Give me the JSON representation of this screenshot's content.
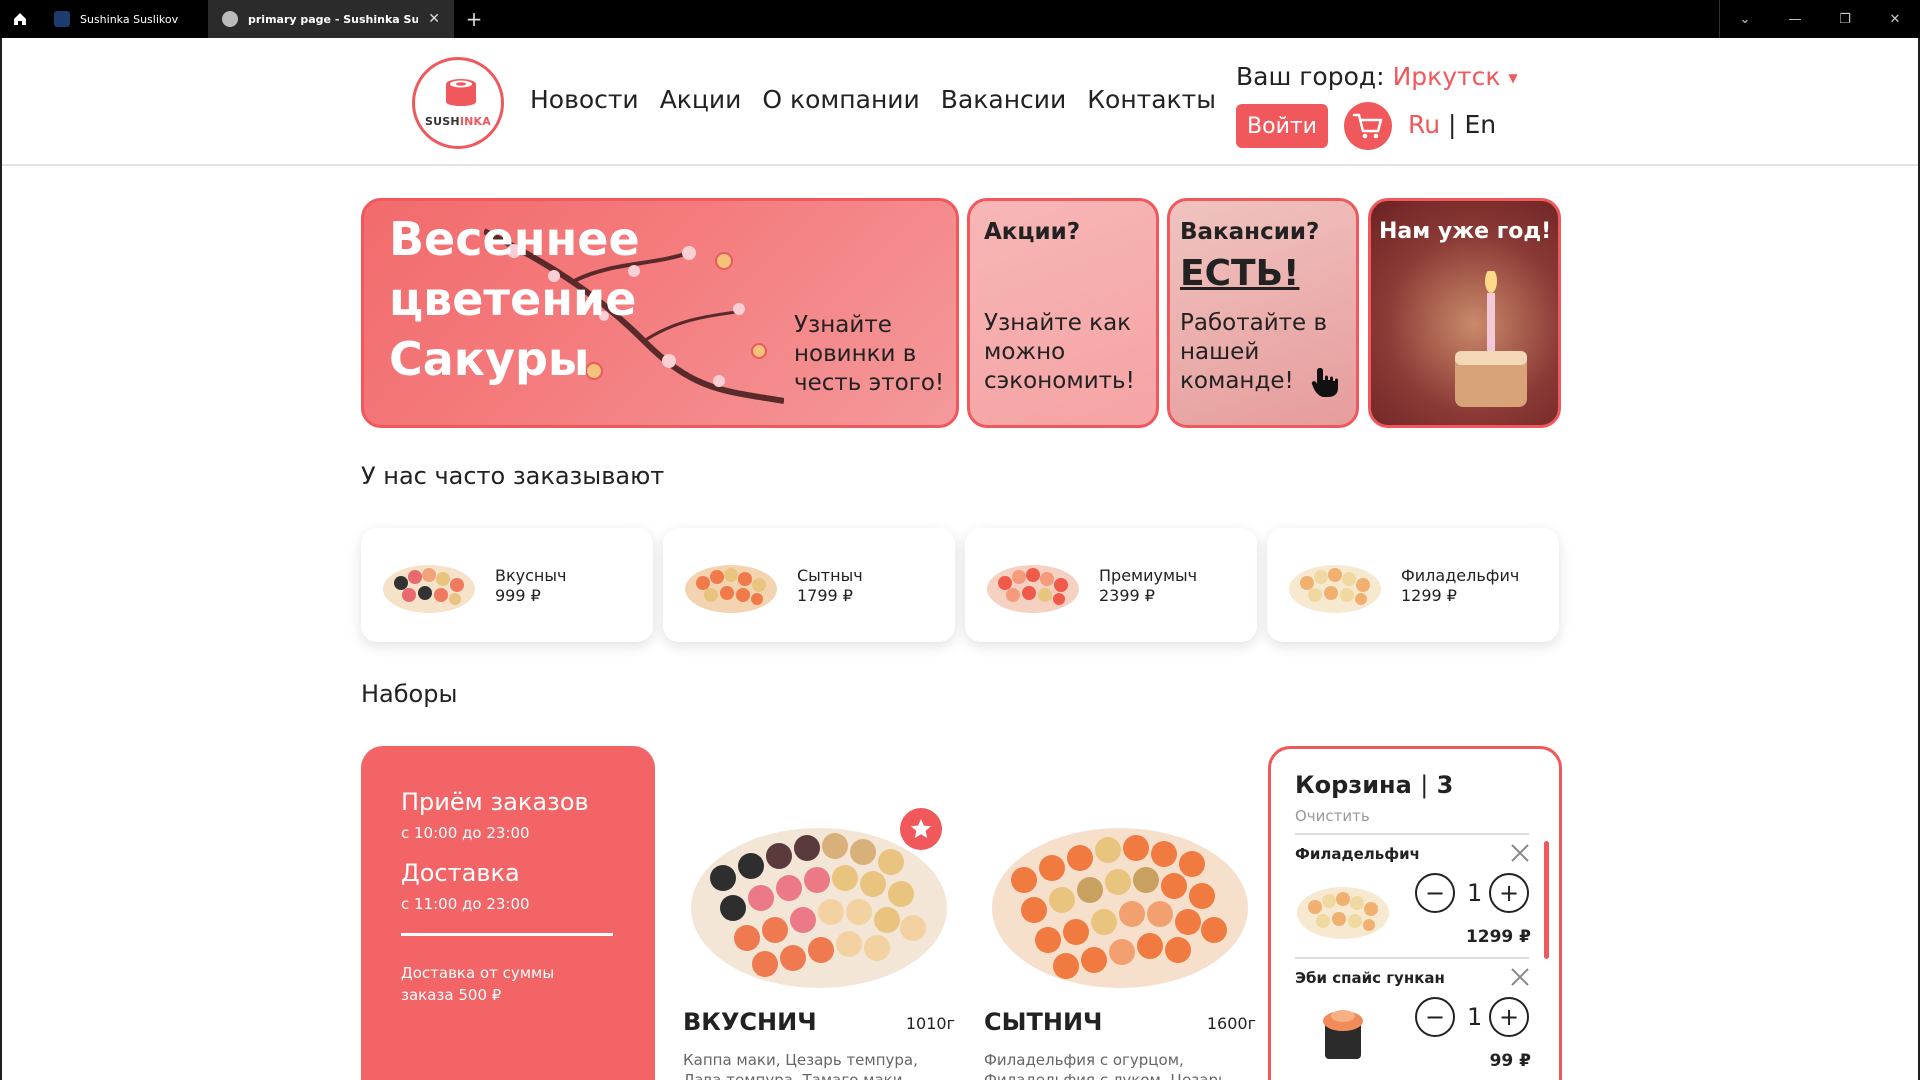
{
  "browser": {
    "tabs": [
      {
        "title": "Sushinka Suslikov"
      },
      {
        "title": "primary page - Sushinka Suslikov",
        "close": "✕"
      }
    ],
    "new_tab": "+"
  },
  "header": {
    "logo": {
      "part1": "SUSH",
      "part2": "INKA"
    },
    "nav": [
      "Новости",
      "Акции",
      "О компании",
      "Вакансии",
      "Контакты"
    ],
    "city_label": "Ваш город:",
    "city_value": "Иркутск",
    "login": "Войти",
    "lang_ru": "Ru",
    "lang_sep": "|",
    "lang_en": "En"
  },
  "banners": {
    "main": {
      "line1": "Весеннее",
      "line2": "цветение",
      "line3": "Сакуры",
      "text": "Узнайте новинки в честь этого!"
    },
    "promo": {
      "title": "Акции?",
      "text": "Узнайте как можно сэкономить!"
    },
    "jobs": {
      "title": "Вакансии?",
      "big": "ЕСТЬ!",
      "text": "Работайте в нашей команде!"
    },
    "year": {
      "title": "Нам уже год!"
    }
  },
  "popular": {
    "title": "У нас часто заказывают",
    "items": [
      {
        "name": "Вкусныч",
        "price": "999 ₽"
      },
      {
        "name": "Сытныч",
        "price": "1799 ₽"
      },
      {
        "name": "Премиумыч",
        "price": "2399 ₽"
      },
      {
        "name": "Филадельфич",
        "price": "1299 ₽"
      }
    ]
  },
  "sets": {
    "title": "Наборы",
    "info": {
      "orders_title": "Приём заказов",
      "orders_hours": "с 10:00 до 23:00",
      "delivery_title": "Доставка",
      "delivery_hours": "с 11:00 до 23:00",
      "note": "Доставка от суммы заказа 500 ₽"
    },
    "items": [
      {
        "name": "ВКУСНИЧ",
        "weight": "1010г",
        "desc": "Каппа маки, Цезарь темпура, Лава темпура, Тамаго маки, Филадельфия лосось лайт."
      },
      {
        "name": "СЫТНИЧ",
        "weight": "1600г",
        "desc": "Филадельфия с огурцом, Филадельфия с луком, Цезарь темпура,"
      }
    ]
  },
  "cart": {
    "title": "Корзина",
    "sep": "|",
    "count": "3",
    "clear": "Очистить",
    "items": [
      {
        "name": "Филадельфич",
        "qty": "1",
        "price": "1299 ₽"
      },
      {
        "name": "Эби спайс гункан",
        "qty": "1",
        "price": "99 ₽"
      }
    ]
  },
  "colors": {
    "accent": "#f0585b",
    "text": "#222222"
  }
}
